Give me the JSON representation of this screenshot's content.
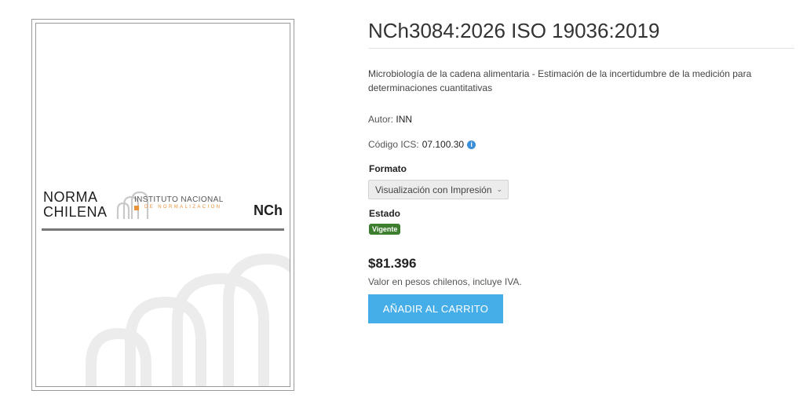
{
  "cover": {
    "line1": "NORMA",
    "line2": "CHILENA",
    "inn_line1": "INSTITUTO NACIONAL",
    "inn_line2": "DE NORMALIZACION",
    "code": "NCh"
  },
  "product": {
    "title": "NCh3084:2026 ISO 19036:2019",
    "description": "Microbiología de la cadena alimentaria - Estimación de la incertidumbre de la medición para determinaciones cuantitativas",
    "autor_label": "Autor:",
    "autor_value": "INN",
    "ics_label": "Código ICS:",
    "ics_value": "07.100.30",
    "info_icon": "i"
  },
  "formato": {
    "label": "Formato",
    "selected": "Visualización con Impresión",
    "chevron": "⌄"
  },
  "estado": {
    "label": "Estado",
    "badge": "Vigente",
    "badge_color": "#3c7d2e"
  },
  "pricing": {
    "price": "$81.396",
    "note": "Valor en pesos chilenos, incluye IVA."
  },
  "cart": {
    "button_label": "AÑADIR AL CARRITO",
    "button_color": "#45aee8"
  }
}
